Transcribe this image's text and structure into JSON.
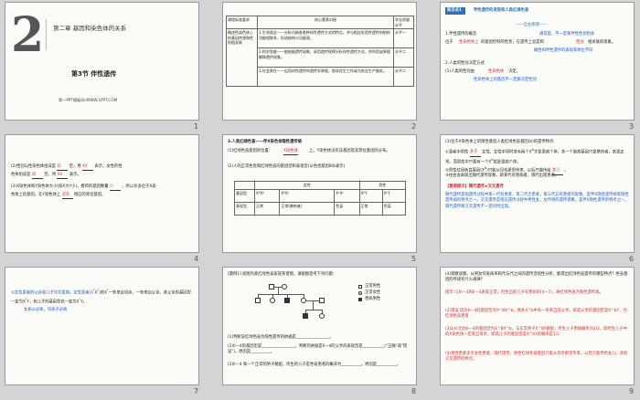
{
  "slides": [
    {
      "number": "1",
      "chapter_num": "2",
      "chapter": "第二章    基因和染色体的关系",
      "section": "第3节    伴性遗传",
      "footer": "第一PPT模板网-WWW.1PPT.COM"
    },
    {
      "number": "2",
      "table": {
        "headers": [
          "课程标准要求",
          "核心素养对接",
          "学业质量水平"
        ],
        "row_label": "概述性染色体上的基因传递和性别相关联",
        "items": [
          {
            "text": "1.生命观念——分析归纳各各种伴性遗传方式的特点，并与相应实验性遗传的结构功能相联系，形成结构与功能观。",
            "level": "水平一"
          },
          {
            "text": "2.科学思维——能根据遗传现象，采用遗传规律分析伴性遗传方式，并利用该原理解释遗传现象。",
            "level": "水平二"
          },
          {
            "text": "3.社会责任——运用伴性遗传的遗传学原理，指导优生工作或为农业生产服务。",
            "level": "水平二"
          }
        ]
      }
    },
    {
      "number": "3",
      "badge": "知识点1",
      "header": "伴性遗传的发现和人类红绿色盲",
      "subheader": "——自主梳理——",
      "lines": [
        {
          "a": "1.伴性遗传的概念",
          "b": "通常是，不一定和伴性性状相关"
        },
        {
          "a": "位于",
          "b": "性染色体上",
          "c": "的基因控制的性状，在遗传上总是和",
          "d": "性别",
          "e": "相关联的现象。"
        },
        {
          "a": "",
          "b": "概性和伴性遗传的表现和体位不同"
        },
        {
          "a": "2.人类的性别决定方式"
        },
        {
          "a": "(1)人类的性别由",
          "b": "性染色体",
          "c": "决定。"
        },
        {
          "a": "",
          "b": "性染色体上的基因不一定都决定性别"
        }
      ]
    },
    {
      "number": "4",
      "lines": [
        "(2)性别与性染色体组成是",
        "   染色体组成为XX，女性为XY。",
        "(3)X染色体和Y染色体大小(如X大Y小)，携带的基因相同，所以与X染色体上的基因，在Y染色体上可能没有相应的等位基因。"
      ],
      "fills": [
        "异",
        "型",
        "XY",
        "XX",
        "同",
        "少",
        "没有"
      ]
    },
    {
      "number": "5",
      "title": "3.人类红绿色盲——伴X染色体隐性遗传病",
      "line1a": "(1)红绿色盲基因的位置：",
      "line1b": "X染色体",
      "line1c": "上。Y染色体没有该基因及其等位基因的分布。",
      "line2": "(2)人的正常色觉和红绿色盲的基因型和表现型(以色觉基因B/b表示)",
      "table": {
        "cols": [
          "",
          "女性",
          "",
          "",
          "男性",
          ""
        ],
        "genotype_label": "基因型",
        "phenotype_label": "表现型",
        "genotypes": [
          "XᴮXᴮ",
          "XᴮXᵇ",
          "XᵇXᵇ",
          "XᴮY",
          "XᵇY"
        ],
        "phenotypes": [
          "正常",
          "正常(携带者)",
          "色盲",
          "正常",
          "色盲"
        ],
        "female": "女性",
        "male": "男性"
      }
    },
    {
      "number": "6",
      "lines": [
        "(3)位于X染色体上的隐性基因人类红绿色盲基因(b)的遗传特点:",
        "①患者中男性_____女性，女性中同时含有两个X^b才是患病个体，含一个致病基因只是携带者，表现正常，而男性中只要有一个X^b就是患病个体。",
        "②男性红绿色盲基因(X^b)只能从母亲那里传来，以后只能传给_______。",
        "③往往会表现出隔代遗传现象，即某代有患病者，隔代出现患者。"
      ],
      "fills": [
        "多于",
        "女儿"
      ],
      "callout_title": "【易错提示】隔代遗传≠交叉遗传",
      "callout": "隔代遗传是指遗传过程中第一代有患者，第二代无患者，第三代又有患者的现象。是伴X隐性遗传病等隐性遗传病的特点之一。交叉遗传是指在遗传过程中男性女，女传男的遗传现象，是伴X隐性遗传的特点之一。隔代遗传和交叉遗传不一定同时出现。"
    },
    {
      "number": "7",
      "line1a": "④女性患者的父亲和儿子均为患病。女性患者(X",
      "line1b": "ᵇ",
      "line1c": "X",
      "line1d": "ᵇ",
      "line1e": ")的X",
      "line1f": "ᵇ",
      "line1g": "一条来自母亲，一条来自父亲，其父亲的基因型一定为X",
      "line1h": "ᵇ",
      "line1i": "Y，其儿子的基因型也一定为X",
      "line1j": "ᵇ",
      "line1k": "Y。",
      "note": "女病父必病，母病子必病"
    },
    {
      "number": "8",
      "title": "[典例1] 如图为某红绿色盲家族系谱图，请据图思考下列问题:",
      "legend": [
        "正常男性",
        "正常女性",
        "患病男性"
      ],
      "q1": "(1)判断该红绿色盲为隐性遗传的依据是_________________。",
      "q2": "(2)II—4的基因型是_________________，判断的依据是II—4的父亲的表现型是___________(\"正确\"或\"错误\")。原因是__________。",
      "q3": "(3)II—4 和一个正常的男子婚配，所生的儿子是色盲患者的概率为__________。原因是__________。"
    },
    {
      "number": "9",
      "lines": [
        "(4)观察该图，从男女的发病率和代与代之间的遗传连续性分析，能得出红绿色盲遗传的哪些特点？色盲基因的传递有什么规律?",
        "提示  (1)II—3和II—4表现正常，但生出的儿子有患病的(II—7)，故红绿色盲为隐性遗传病。",
        "(2)错误  因为II—4的基因型为X^BX^b，两条X^b中有一条来自其父亲，即其父亲的基因型是X^bY，为红绿色盲患者",
        "(3)1/4  因为II—4的基因型为X^BX^b，与正常男子X^BY婚配，所生儿子患病概率为1/2，即所生儿子中的X染色体一定来自母亲，即其儿子的基因型是X^bY的概率是1/2",
        "(4)男性患者多于女性患者；隔代遗传；男性红绿色盲基因只能从母亲那里传来，以后只能传给女儿；具有交叉遗传的特点。"
      ]
    }
  ],
  "colors": {
    "accent_blue": "#1e5bc6",
    "accent_red": "#d42c2c",
    "slide_bg": "#fbfbf7",
    "border": "#9a9a9a"
  }
}
